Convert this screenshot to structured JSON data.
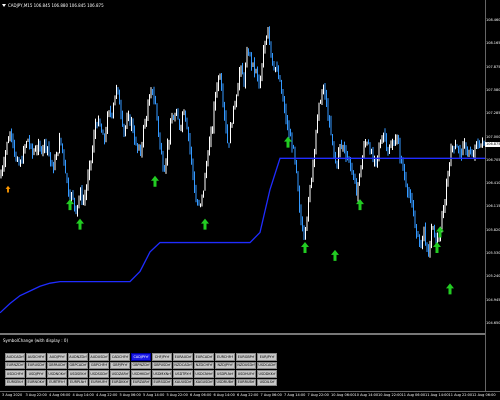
{
  "header": {
    "symbol_line": "CADJPY,M15 106.845 106.880 106.845 106.875"
  },
  "price_axis": {
    "labels": [
      "108.460",
      "108.165",
      "107.875",
      "107.580",
      "107.285",
      "107.000",
      "106.705",
      "106.410",
      "106.115",
      "105.820",
      "105.530",
      "105.240",
      "104.945",
      "104.650"
    ],
    "current_price": "106.875"
  },
  "subwindow": {
    "title": "SymbolChange (with display : 0)"
  },
  "symbols": [
    [
      "AUDCADrf",
      "AUDCHFrf",
      "AUDJPYrf",
      "AUDNZDrf",
      "AUDUSDrf",
      "CADCHFrf",
      "CADJPYrf",
      "CHFJPYrf",
      "EURAUDrf",
      "EURCADrf",
      "EURCHFrf",
      "EURGBPrf",
      "EURJPYrf"
    ],
    [
      "EURNZDrf",
      "EURUSDrf",
      "GBPAUDrf",
      "GBPCADrf",
      "GBPCHFrf",
      "GBPJPYrf",
      "GBPNZDrf",
      "GBPUSDrf",
      "NZDCADrf",
      "NZDCHFrf",
      "NZDJPYrf",
      "NZDUSDrf",
      "USDCADrf"
    ],
    [
      "USDCHFrf",
      "USDJPYrf",
      "USDNOKrf",
      "USDSEKrf",
      "USDSGDrf",
      "USDZARrf",
      "USDHKDrf",
      "USDMXNrf",
      "USDTRYrf",
      "USDCNHrf",
      "USDPLNrf",
      "USDHUFrf",
      "USDDKKrf"
    ],
    [
      "EURSEKrf",
      "EURNOKrf",
      "EURTRYrf",
      "EURPLNrf",
      "EURHUFrf",
      "EURDKKrf",
      "EURZARrf",
      "EURSGDrf",
      "XAUUSDrf",
      "XAGUSDrf",
      "USDRUBrf",
      "EURRUBrf",
      "USDILSrf"
    ]
  ],
  "active_symbol": "CADJPYrf",
  "time_axis": {
    "labels": [
      "3 Aug 2020",
      "3 Aug 22:00",
      "4 Aug 06:00",
      "4 Aug 14:00",
      "4 Aug 22:00",
      "5 Aug 06:00",
      "5 Aug 14:00",
      "5 Aug 22:00",
      "6 Aug 06:00",
      "6 Aug 14:00",
      "6 Aug 22:00",
      "7 Aug 06:00",
      "7 Aug 14:00",
      "7 Aug 22:00",
      "10 Aug 06:00",
      "10 Aug 14:00",
      "10 Aug 22:00",
      "11 Aug 06:00",
      "11 Aug 14:00",
      "11 Aug 22:00",
      "12 Aug 06:00"
    ]
  },
  "colors": {
    "background": "#000000",
    "bull_bar": "#ffffff",
    "bear_bar": "#3399ff",
    "trend_line": "#1f2cff",
    "arrow_green": "#22cc22",
    "arrow_orange": "#ff9900",
    "active_button": "#1a1ae6"
  },
  "chart_data": {
    "type": "ohlc",
    "ylim": [
      104.5,
      108.6
    ],
    "price_series": [
      [
        0,
        106.45
      ],
      [
        4,
        106.7
      ],
      [
        8,
        106.95
      ],
      [
        12,
        107.05
      ],
      [
        16,
        106.65
      ],
      [
        20,
        106.6
      ],
      [
        24,
        106.8
      ],
      [
        28,
        106.95
      ],
      [
        32,
        106.75
      ],
      [
        36,
        106.85
      ],
      [
        40,
        106.8
      ],
      [
        44,
        106.9
      ],
      [
        48,
        106.85
      ],
      [
        52,
        106.55
      ],
      [
        56,
        106.7
      ],
      [
        60,
        106.95
      ],
      [
        64,
        106.7
      ],
      [
        68,
        106.3
      ],
      [
        72,
        106.2
      ],
      [
        76,
        106.05
      ],
      [
        80,
        106.25
      ],
      [
        84,
        106.15
      ],
      [
        88,
        106.45
      ],
      [
        92,
        106.75
      ],
      [
        96,
        107.2
      ],
      [
        100,
        107.1
      ],
      [
        104,
        106.9
      ],
      [
        108,
        107.25
      ],
      [
        112,
        107.3
      ],
      [
        116,
        107.6
      ],
      [
        120,
        107.4
      ],
      [
        124,
        107.05
      ],
      [
        128,
        107.2
      ],
      [
        132,
        107.15
      ],
      [
        136,
        106.85
      ],
      [
        140,
        106.75
      ],
      [
        144,
        107.1
      ],
      [
        148,
        107.35
      ],
      [
        152,
        107.6
      ],
      [
        156,
        107.35
      ],
      [
        160,
        106.85
      ],
      [
        164,
        106.55
      ],
      [
        168,
        106.9
      ],
      [
        172,
        107.2
      ],
      [
        176,
        107.25
      ],
      [
        180,
        107.1
      ],
      [
        184,
        107.35
      ],
      [
        188,
        107.05
      ],
      [
        192,
        106.6
      ],
      [
        196,
        106.15
      ],
      [
        200,
        106.05
      ],
      [
        204,
        106.35
      ],
      [
        208,
        106.8
      ],
      [
        212,
        107.05
      ],
      [
        216,
        107.6
      ],
      [
        220,
        107.8
      ],
      [
        224,
        107.35
      ],
      [
        228,
        106.85
      ],
      [
        232,
        107.2
      ],
      [
        236,
        107.5
      ],
      [
        240,
        107.85
      ],
      [
        244,
        107.7
      ],
      [
        248,
        108.1
      ],
      [
        252,
        107.9
      ],
      [
        256,
        107.8
      ],
      [
        260,
        107.6
      ],
      [
        264,
        108.1
      ],
      [
        268,
        108.4
      ],
      [
        272,
        107.95
      ],
      [
        276,
        107.85
      ],
      [
        280,
        107.65
      ],
      [
        284,
        107.35
      ],
      [
        288,
        107.05
      ],
      [
        292,
        106.9
      ],
      [
        296,
        106.55
      ],
      [
        300,
        105.95
      ],
      [
        304,
        105.75
      ],
      [
        308,
        106.05
      ],
      [
        312,
        106.55
      ],
      [
        316,
        107.05
      ],
      [
        320,
        107.45
      ],
      [
        324,
        107.6
      ],
      [
        328,
        107.25
      ],
      [
        332,
        106.9
      ],
      [
        336,
        106.6
      ],
      [
        340,
        106.85
      ],
      [
        344,
        106.85
      ],
      [
        348,
        106.7
      ],
      [
        352,
        106.55
      ],
      [
        356,
        106.25
      ],
      [
        360,
        106.5
      ],
      [
        364,
        106.85
      ],
      [
        368,
        106.95
      ],
      [
        372,
        106.7
      ],
      [
        376,
        106.6
      ],
      [
        380,
        106.9
      ],
      [
        384,
        107.05
      ],
      [
        388,
        106.8
      ],
      [
        392,
        106.85
      ],
      [
        396,
        107.0
      ],
      [
        400,
        106.75
      ],
      [
        404,
        106.5
      ],
      [
        408,
        106.3
      ],
      [
        412,
        106.05
      ],
      [
        416,
        105.8
      ],
      [
        420,
        105.55
      ],
      [
        424,
        105.8
      ],
      [
        428,
        105.4
      ],
      [
        432,
        105.85
      ],
      [
        436,
        105.6
      ],
      [
        440,
        105.75
      ],
      [
        444,
        106.05
      ],
      [
        448,
        106.55
      ],
      [
        452,
        106.85
      ],
      [
        456,
        106.9
      ],
      [
        460,
        106.75
      ],
      [
        464,
        106.85
      ],
      [
        468,
        106.8
      ],
      [
        472,
        106.7
      ],
      [
        476,
        106.85
      ],
      [
        480,
        106.9
      ],
      [
        484,
        106.87
      ]
    ],
    "trend_line": [
      [
        0,
        104.72
      ],
      [
        10,
        104.84
      ],
      [
        20,
        104.94
      ],
      [
        30,
        105.0
      ],
      [
        40,
        105.06
      ],
      [
        50,
        105.1
      ],
      [
        60,
        105.12
      ],
      [
        70,
        105.12
      ],
      [
        80,
        105.12
      ],
      [
        90,
        105.12
      ],
      [
        100,
        105.12
      ],
      [
        110,
        105.12
      ],
      [
        120,
        105.12
      ],
      [
        130,
        105.12
      ],
      [
        140,
        105.25
      ],
      [
        150,
        105.5
      ],
      [
        160,
        105.62
      ],
      [
        170,
        105.62
      ],
      [
        180,
        105.62
      ],
      [
        190,
        105.62
      ],
      [
        200,
        105.62
      ],
      [
        210,
        105.62
      ],
      [
        220,
        105.62
      ],
      [
        230,
        105.62
      ],
      [
        240,
        105.62
      ],
      [
        250,
        105.62
      ],
      [
        260,
        105.75
      ],
      [
        270,
        106.3
      ],
      [
        280,
        106.7
      ],
      [
        290,
        106.7
      ],
      [
        300,
        106.7
      ],
      [
        320,
        106.7
      ],
      [
        340,
        106.7
      ],
      [
        360,
        106.7
      ],
      [
        380,
        106.7
      ],
      [
        400,
        106.7
      ],
      [
        420,
        106.7
      ],
      [
        440,
        106.7
      ],
      [
        460,
        106.7
      ],
      [
        485,
        106.7
      ]
    ],
    "up_arrows": [
      [
        70,
        106.1
      ],
      [
        80,
        105.85
      ],
      [
        155,
        106.4
      ],
      [
        205,
        105.85
      ],
      [
        288,
        106.9
      ],
      [
        305,
        105.55
      ],
      [
        335,
        105.45
      ],
      [
        360,
        106.1
      ],
      [
        437,
        105.55
      ],
      [
        440,
        105.75
      ],
      [
        450,
        105.02
      ]
    ],
    "orange_arrows": [
      [
        8,
        106.3
      ]
    ]
  }
}
